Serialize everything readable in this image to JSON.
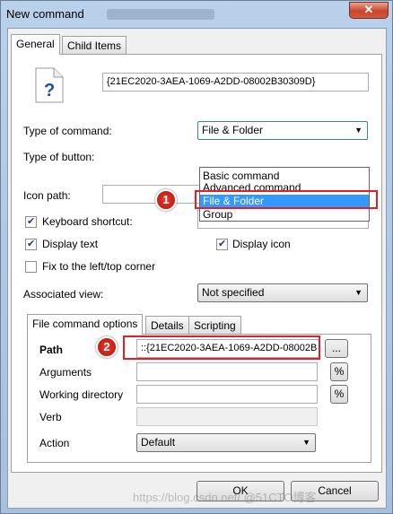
{
  "window": {
    "title": "New command",
    "close_glyph": "✕"
  },
  "tabs": [
    "General",
    "Child Items"
  ],
  "general": {
    "guid": "{21EC2020-3AEA-1069-A2DD-08002B30309D}",
    "type_of_command_label": "Type of command:",
    "type_of_command_value": "File & Folder",
    "type_of_button_label": "Type of button:",
    "type_options": [
      "Basic command",
      "Advanced command",
      "File & Folder",
      "Group"
    ],
    "icon_path_label": "Icon path:",
    "icon_path_value": "",
    "browse_glyph": "...",
    "keyboard_shortcut_label": "Keyboard shortcut:",
    "keyboard_shortcut_checked": true,
    "display_text_label": "Display text",
    "display_text_checked": true,
    "display_icon_label": "Display icon",
    "display_icon_checked": true,
    "fix_corner_label": "Fix to the left/top corner",
    "fix_corner_checked": false,
    "associated_view_label": "Associated view:",
    "associated_view_value": "Not specified"
  },
  "subtabs": [
    "File command options",
    "Details",
    "Scripting"
  ],
  "file_options": {
    "path_label": "Path",
    "path_value": "::{21EC2020-3AEA-1069-A2DD-08002B",
    "arguments_label": "Arguments",
    "working_directory_label": "Working directory",
    "verb_label": "Verb",
    "action_label": "Action",
    "action_value": "Default",
    "percent_glyph": "%"
  },
  "callouts": [
    "1",
    "2"
  ],
  "buttons": {
    "ok": "OK",
    "cancel": "Cancel"
  },
  "watermark": "https://blog.csdn.net/ @51CTO博客",
  "colors": {
    "callout": "#e31e24",
    "selection": "#3399ff"
  }
}
